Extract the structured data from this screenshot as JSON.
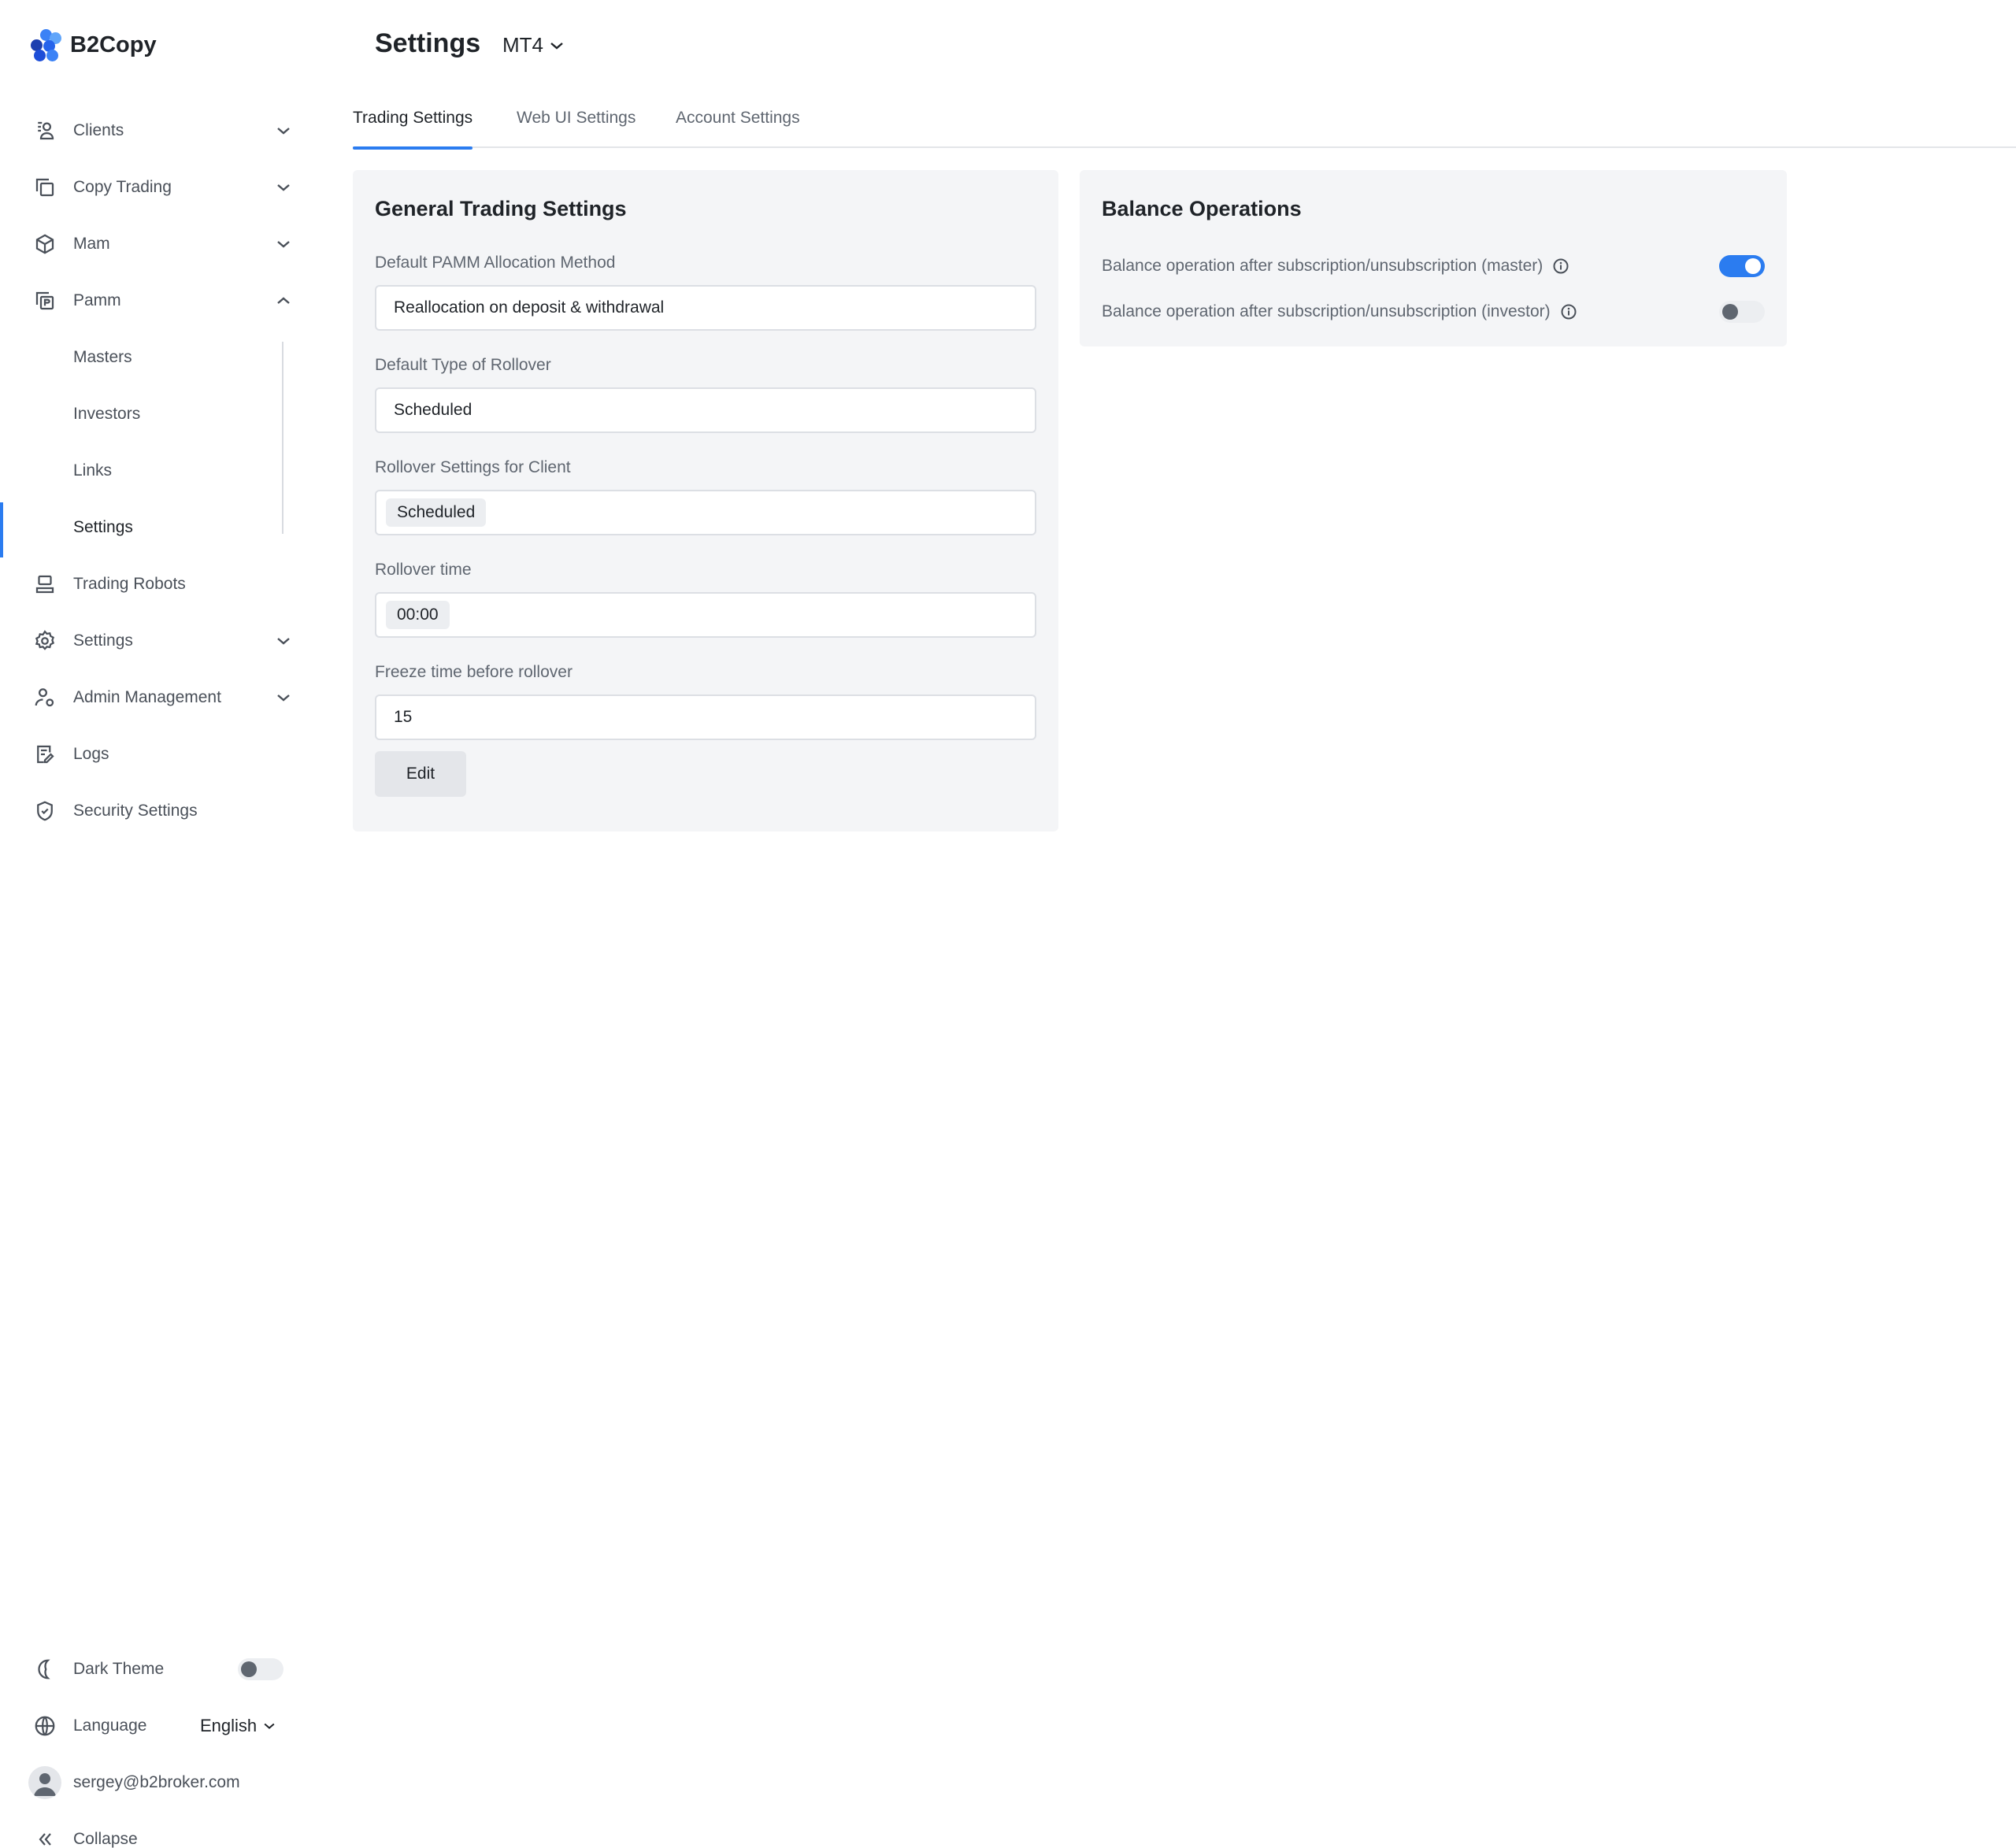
{
  "brand": {
    "name": "B2Copy"
  },
  "sidebar": {
    "items": [
      {
        "label": "Clients",
        "icon": "users-icon",
        "expandable": true
      },
      {
        "label": "Copy Trading",
        "icon": "copy-icon",
        "expandable": true
      },
      {
        "label": "Mam",
        "icon": "cube-icon",
        "expandable": true
      },
      {
        "label": "Pamm",
        "icon": "pamm-icon",
        "expanded": true
      }
    ],
    "pamm_sub": [
      {
        "label": "Masters"
      },
      {
        "label": "Investors"
      },
      {
        "label": "Links"
      },
      {
        "label": "Settings",
        "active": true
      }
    ],
    "items_after": [
      {
        "label": "Trading Robots",
        "icon": "robot-icon"
      },
      {
        "label": "Settings",
        "icon": "gear-icon",
        "expandable": true
      },
      {
        "label": "Admin Management",
        "icon": "admin-icon",
        "expandable": true
      },
      {
        "label": "Logs",
        "icon": "logs-icon"
      },
      {
        "label": "Security Settings",
        "icon": "shield-icon"
      }
    ],
    "bottom": {
      "dark_theme_label": "Dark Theme",
      "dark_theme_on": false,
      "language_label": "Language",
      "language_value": "English",
      "user_email": "sergey@b2broker.com",
      "collapse_label": "Collapse"
    }
  },
  "header": {
    "title": "Settings",
    "platform": "MT4"
  },
  "tabs": [
    {
      "label": "Trading Settings",
      "active": true
    },
    {
      "label": "Web UI Settings"
    },
    {
      "label": "Account Settings"
    }
  ],
  "general": {
    "title": "General Trading Settings",
    "fields": [
      {
        "label": "Default PAMM Allocation Method",
        "value": "Reallocation on deposit & withdrawal"
      },
      {
        "label": "Default Type of Rollover",
        "value": "Scheduled"
      },
      {
        "label": "Rollover Settings for Client",
        "value": "Scheduled"
      },
      {
        "label": "Rollover time",
        "value": "00:00"
      },
      {
        "label": "Freeze time before rollover",
        "value": "15"
      }
    ],
    "edit_label": "Edit"
  },
  "balance": {
    "title": "Balance Operations",
    "rows": [
      {
        "label": "Balance operation after subscription/unsubscription (master)",
        "on": true
      },
      {
        "label": "Balance operation after subscription/unsubscription (investor)",
        "on": false
      }
    ]
  },
  "colors": {
    "accent": "#2b7cf0",
    "card_bg": "#f4f5f7"
  }
}
